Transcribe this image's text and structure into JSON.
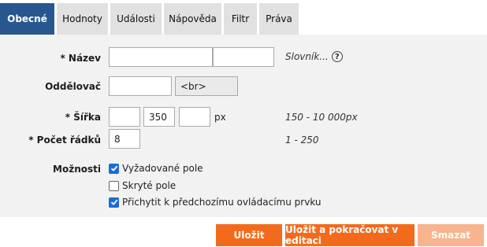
{
  "tabs": [
    {
      "label": "Obecné",
      "active": true
    },
    {
      "label": "Hodnoty"
    },
    {
      "label": "Události"
    },
    {
      "label": "Nápověda"
    },
    {
      "label": "Filtr"
    },
    {
      "label": "Práva"
    }
  ],
  "form": {
    "name": {
      "label": "* Název",
      "value1": "",
      "value2": "",
      "dictionary_label": "Slovník...",
      "help_icon": "question-circle-icon"
    },
    "separator": {
      "label": "Oddělovač",
      "value": "",
      "preview": "<br>"
    },
    "width": {
      "label": "* Šířka",
      "value1": "",
      "value2": "350",
      "value3": "",
      "unit": "px",
      "hint": "150 - 10 000px"
    },
    "rows": {
      "label": "* Počet řádků",
      "value": "8",
      "hint": "1 - 250"
    },
    "options": {
      "label": "Možnosti",
      "items": [
        {
          "label": "Vyžadované pole",
          "checked": true
        },
        {
          "label": "Skryté pole",
          "checked": false
        },
        {
          "label": "Přichytit k předchozímu ovládacímu prvku",
          "checked": true
        }
      ]
    }
  },
  "buttons": {
    "save": "Uložit",
    "save_continue": "Uložit a pokračovat v editaci",
    "delete": "Smazat"
  },
  "colors": {
    "active_tab": "#28578f",
    "primary_button": "#f26b1d",
    "disabled_button": "#f7b48f",
    "checkbox": "#1a6dd6"
  }
}
